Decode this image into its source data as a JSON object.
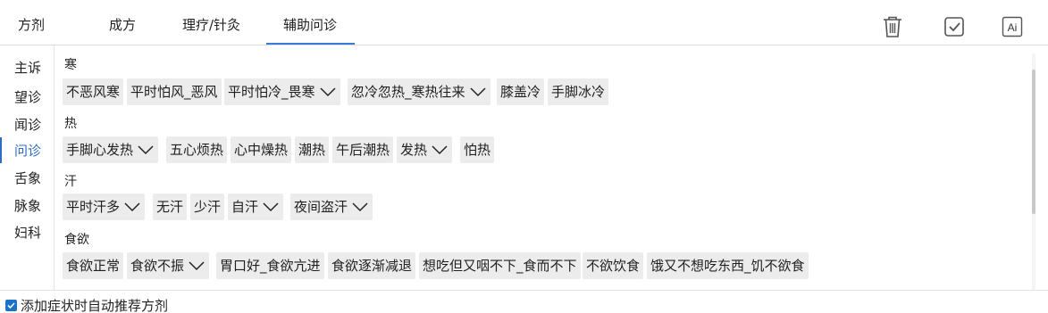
{
  "tabs": [
    {
      "label": "方剂"
    },
    {
      "label": "成方"
    },
    {
      "label": "理疗/针灸"
    },
    {
      "label": "辅助问诊",
      "active": true
    }
  ],
  "toolbar": {
    "delete_icon": "trash-icon",
    "confirm_icon": "checkbox-icon",
    "ai_label": "Ai"
  },
  "sidenav": {
    "items": [
      {
        "label": "主诉"
      },
      {
        "label": "望诊"
      },
      {
        "label": "闻诊"
      },
      {
        "label": "问诊",
        "active": true
      },
      {
        "label": "舌象"
      },
      {
        "label": "脉象"
      },
      {
        "label": "妇科"
      }
    ]
  },
  "groups": [
    {
      "title": "寒",
      "chips": [
        {
          "label": "不恶风寒"
        },
        {
          "label": "平时怕风_恶风"
        },
        {
          "label": "平时怕冷_畏寒",
          "dropdown": true
        },
        {
          "label": "忽冷忽热_寒热往来",
          "dropdown": true
        },
        {
          "label": "膝盖冷"
        },
        {
          "label": "手脚冰冷"
        }
      ]
    },
    {
      "title": "热",
      "chips": [
        {
          "label": "手脚心发热",
          "dropdown": true
        },
        {
          "label": "五心烦热"
        },
        {
          "label": "心中燥热"
        },
        {
          "label": "潮热"
        },
        {
          "label": "午后潮热"
        },
        {
          "label": "发热",
          "dropdown": true
        },
        {
          "label": "怕热"
        }
      ]
    },
    {
      "title": "汗",
      "chips": [
        {
          "label": "平时汗多",
          "dropdown": true
        },
        {
          "label": "无汗"
        },
        {
          "label": "少汗"
        },
        {
          "label": "自汗",
          "dropdown": true
        },
        {
          "label": "夜间盗汗",
          "dropdown": true
        }
      ]
    },
    {
      "title": "食欲",
      "chips": [
        {
          "label": "食欲正常"
        },
        {
          "label": "食欲不振",
          "dropdown": true
        },
        {
          "label": "胃口好_食欲亢进"
        },
        {
          "label": "食欲逐渐减退"
        },
        {
          "label": "想吃但又咽不下_食而不下"
        },
        {
          "label": "不欲饮食"
        },
        {
          "label": "饿又不想吃东西_饥不欲食"
        }
      ]
    }
  ],
  "footer": {
    "auto_recommend_label": "添加症状时自动推荐方剂",
    "auto_recommend_checked": true
  },
  "colors": {
    "accent": "#3a7bd5",
    "chip_bg": "#ececec",
    "checkbox": "#1a73c9"
  }
}
